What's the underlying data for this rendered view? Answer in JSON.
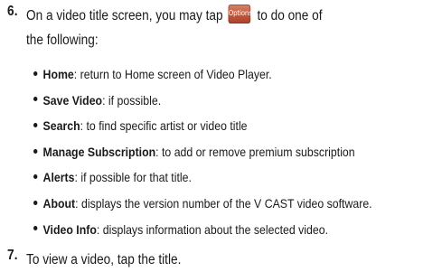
{
  "step6": {
    "number": "6.",
    "text_before_button": "On a video title screen, you may tap",
    "button_label": "Options",
    "text_after_button": "to do one of",
    "text_line2": "the following:"
  },
  "bullets": [
    {
      "term": "Home",
      "desc": ": return to Home screen of Video Player."
    },
    {
      "term": "Save Video",
      "desc": ": if possible."
    },
    {
      "term": "Search",
      "desc": ": to find specific artist or video title"
    },
    {
      "term": "Manage Subscription",
      "desc": ": to add or remove premium subscription"
    },
    {
      "term": "Alerts",
      "desc": ": if possible for that title."
    },
    {
      "term": "About",
      "desc": ": displays the version number of the V CAST video software."
    },
    {
      "term": "Video Info",
      "desc": ": displays information about the selected video."
    }
  ],
  "step7": {
    "number": "7.",
    "text": "To view a video, tap the title."
  },
  "colors": {
    "text": "#1a1a1a",
    "options_button": "#c0573b"
  }
}
